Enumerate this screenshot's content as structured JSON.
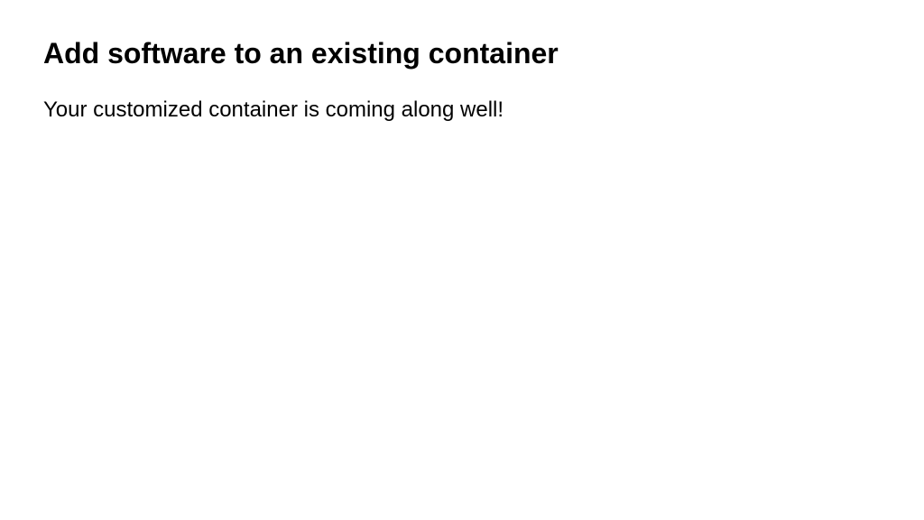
{
  "heading": "Add software to an existing container",
  "body": "Your customized container is coming along well!"
}
